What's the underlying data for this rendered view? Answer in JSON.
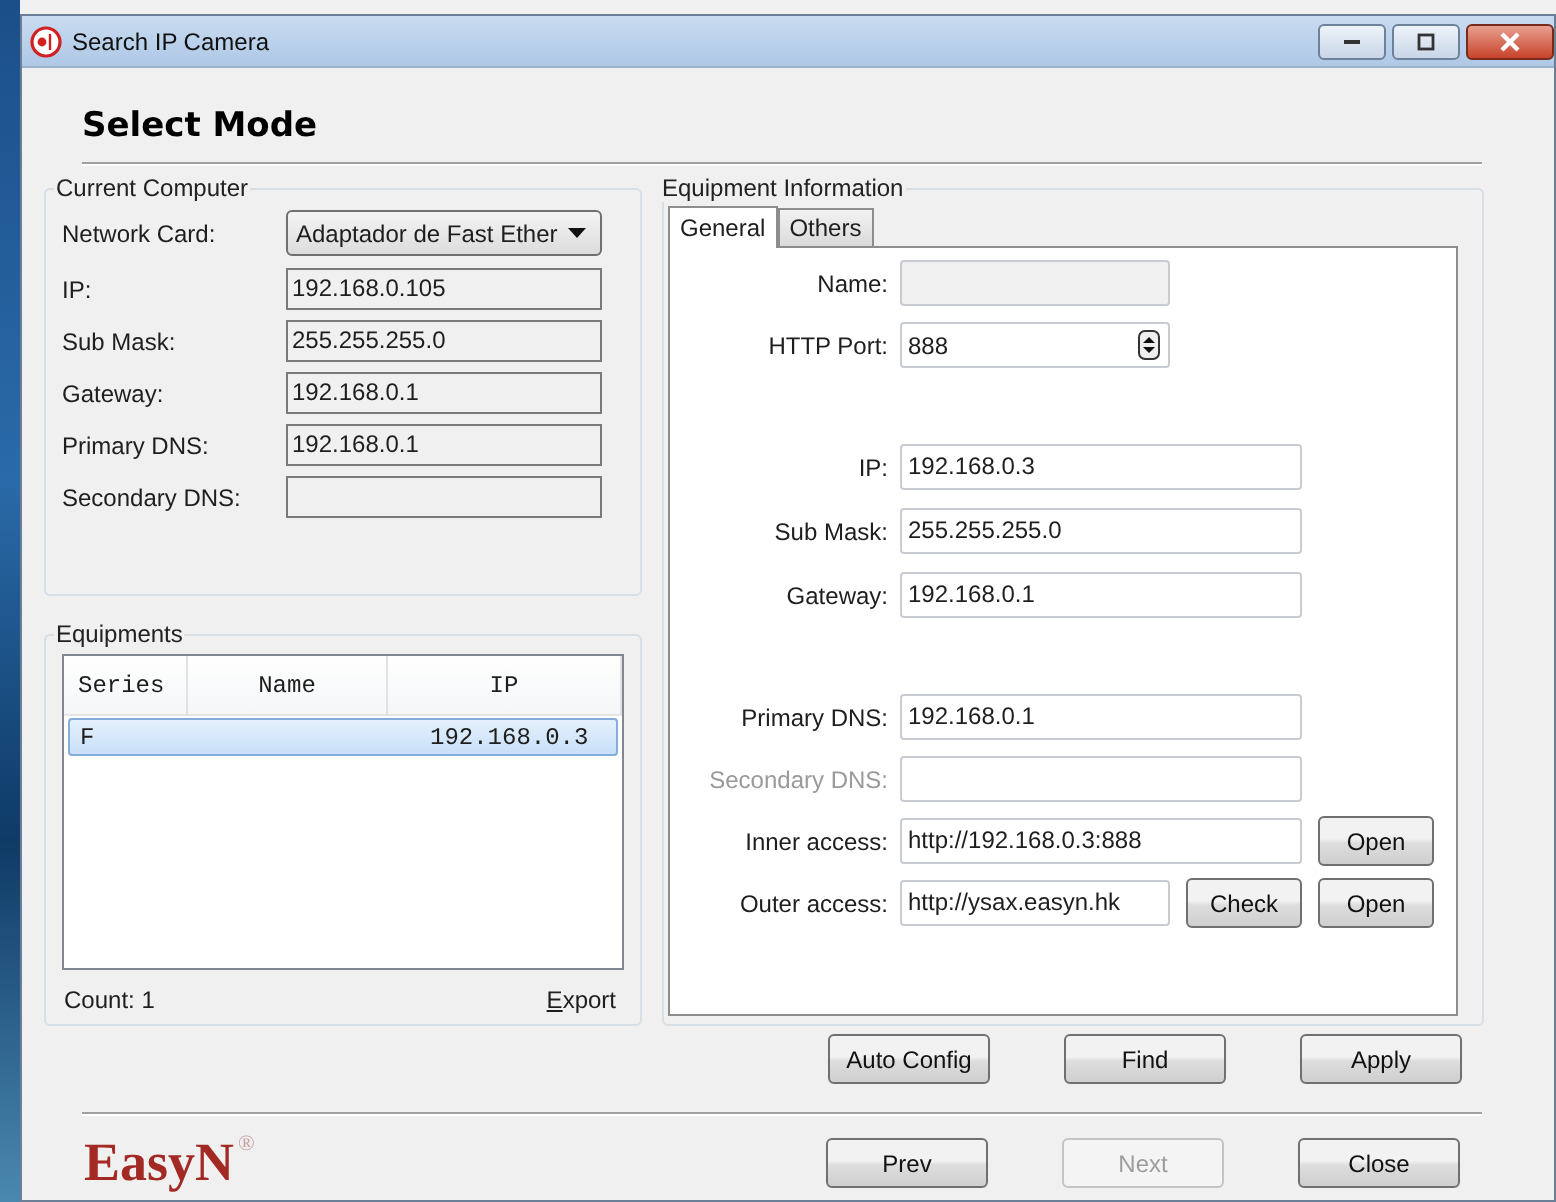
{
  "window": {
    "title": "Search IP Camera"
  },
  "heading": "Select Mode",
  "current_computer": {
    "title": "Current Computer",
    "network_card": {
      "label": "Network Card:",
      "value": "Adaptador de Fast Ether"
    },
    "fields": [
      {
        "label": "IP:",
        "value": "192.168.0.105"
      },
      {
        "label": "Sub Mask:",
        "value": "255.255.255.0"
      },
      {
        "label": "Gateway:",
        "value": "192.168.0.1"
      },
      {
        "label": "Primary DNS:",
        "value": "192.168.0.1"
      },
      {
        "label": "Secondary DNS:"
      }
    ]
  },
  "equipments": {
    "title": "Equipments",
    "columns": [
      "Series",
      "Name",
      "IP"
    ],
    "rows": [
      {
        "series": "F",
        "ip": "192.168.0.3",
        "selected": true
      }
    ],
    "count": "Count: 1",
    "export": "Export"
  },
  "equipment_information": {
    "title": "Equipment Information",
    "tabs": [
      {
        "label": "General",
        "selected": true
      },
      {
        "label": "Others",
        "selected": false
      }
    ],
    "field_groups": [
      [
        {
          "kind": "text",
          "label": "Name:",
          "readonly": true,
          "disabled": false
        },
        {
          "kind": "spin",
          "label": "HTTP Port:",
          "value": "888",
          "readonly": false,
          "disabled": false
        }
      ],
      [
        {
          "kind": "text",
          "label": "IP:",
          "value": "192.168.0.3",
          "readonly": false,
          "disabled": false
        },
        {
          "kind": "text",
          "label": "Sub Mask:",
          "value": "255.255.255.0",
          "readonly": false,
          "disabled": false
        },
        {
          "kind": "text",
          "label": "Gateway:",
          "value": "192.168.0.1",
          "readonly": false,
          "disabled": false
        }
      ],
      [
        {
          "kind": "text",
          "label": "Primary DNS:",
          "value": "192.168.0.1",
          "readonly": false,
          "disabled": false
        },
        {
          "kind": "text",
          "label": "Secondary DNS:",
          "readonly": false,
          "disabled": true
        },
        {
          "kind": "text",
          "label": "Inner access:",
          "value": "http://192.168.0.3:888",
          "readonly": false,
          "disabled": false,
          "buttons": [
            "Open"
          ]
        },
        {
          "kind": "text",
          "label": "Outer access:",
          "value": "http://ysax.easyn.hk",
          "readonly": false,
          "disabled": false,
          "buttons": [
            "Check",
            "Open"
          ]
        }
      ]
    ]
  },
  "action_buttons": [
    {
      "label": "Auto Config",
      "disabled": false
    },
    {
      "label": "Find",
      "disabled": false
    },
    {
      "label": "Apply",
      "disabled": false
    }
  ],
  "brand": {
    "name": "EasyN",
    "mark": "®"
  },
  "nav_buttons": [
    {
      "label": "Prev",
      "disabled": false
    },
    {
      "label": "Next",
      "disabled": true
    },
    {
      "label": "Close",
      "disabled": false
    }
  ]
}
